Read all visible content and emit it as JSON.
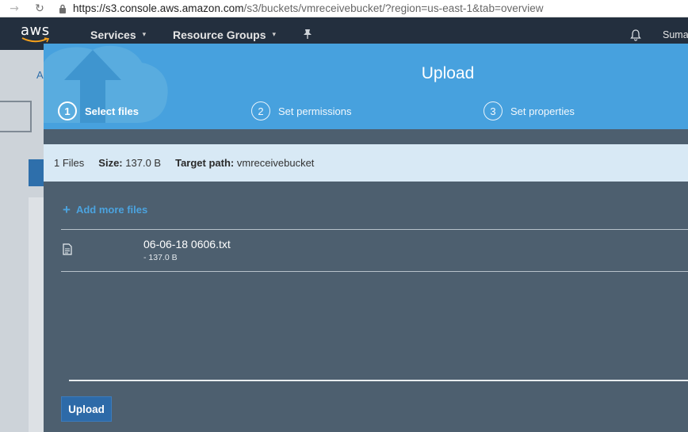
{
  "browser": {
    "url_host": "https://s3.console.aws.amazon.com",
    "url_path": "/s3/buckets/vmreceivebucket/?region=us-east-1&tab=overview"
  },
  "awsnav": {
    "logo_text": "aws",
    "services_label": "Services",
    "resource_groups_label": "Resource Groups",
    "user_label": "Suma"
  },
  "background_page": {
    "crumb_initial": "A"
  },
  "modal": {
    "title": "Upload",
    "steps": [
      {
        "number": "1",
        "label": "Select files",
        "active": true
      },
      {
        "number": "2",
        "label": "Set permissions",
        "active": false
      },
      {
        "number": "3",
        "label": "Set properties",
        "active": false
      }
    ],
    "summary": {
      "files_count": "1 Files",
      "size_label": "Size:",
      "size_value": "137.0 B",
      "target_label": "Target path:",
      "target_value": "vmreceivebucket"
    },
    "add_more_label": "Add more files",
    "files": [
      {
        "name": "06-06-18 0606.txt",
        "size": "- 137.0 B"
      }
    ],
    "upload_button": "Upload"
  },
  "colors": {
    "header_blue": "#47a1de",
    "modal_body": "#4d5f6f",
    "aws_nav": "#232f3e",
    "link_blue": "#4ba3df",
    "button_blue": "#2d6aa8"
  }
}
